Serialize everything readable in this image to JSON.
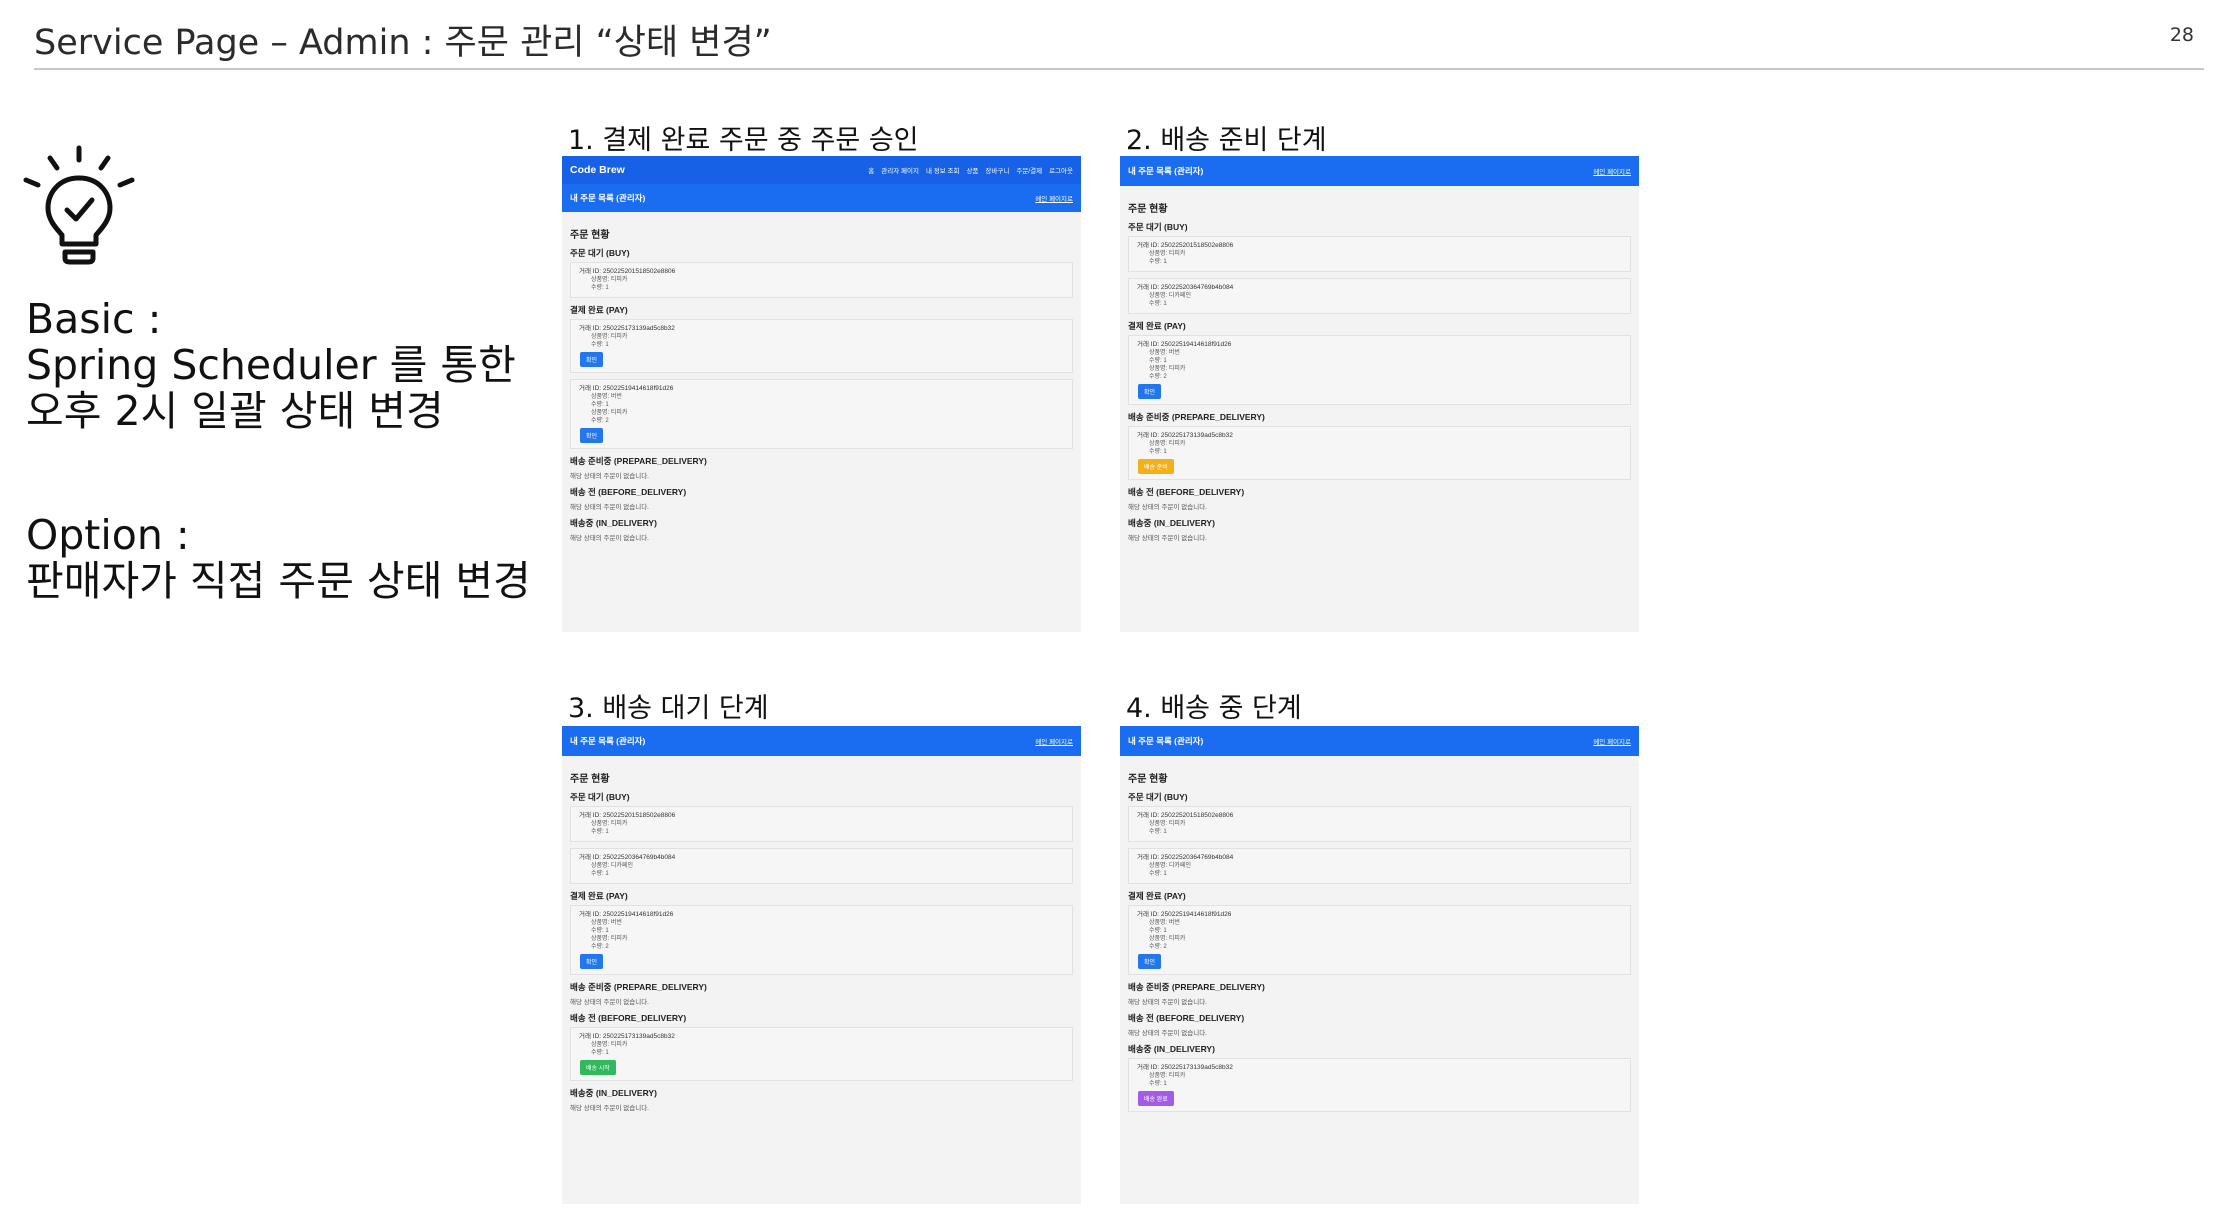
{
  "slide": {
    "title": "Service Page – Admin : 주문 관리 “상태 변경”",
    "page_number": "28",
    "basic_label": "Basic :",
    "basic_lines": [
      "Spring Scheduler 를 통한",
      "오후 2시 일괄 상태 변경"
    ],
    "option_label": "Option :",
    "option_line": "판매자가 직접 주문 상태 변경",
    "icon": "lightbulb-check-icon"
  },
  "nav": {
    "brand": "Code Brew",
    "links": [
      "홈",
      "관리자 페이지",
      "내 정보 조회",
      "상품",
      "장바구니",
      "주문/결제",
      "로그아웃"
    ]
  },
  "common": {
    "bar_title": "내 주문 목록 (관리자)",
    "mypage_link": "메인 페이지로",
    "status_heading": "주문 현황",
    "empty_text": "해당 상태의 주문이 없습니다.",
    "sec_buy": "주문 대기 (BUY)",
    "sec_pay": "결제 완료 (PAY)",
    "sec_prepare": "배송 준비중 (PREPARE_DELIVERY)",
    "sec_before": "배송 전 (BEFORE_DELIVERY)",
    "sec_in": "배송중 (IN_DELIVERY)",
    "tx_a": "거래 ID: 2502252015185​02e8806",
    "tx_b": "거래 ID: 250225173139ad5c8b32",
    "tx_c": "거래 ID: 2502251941461​8f91d26",
    "tx_d": "거래 ID: 250225203647​69b4b084",
    "prod_tiramisu": "상품명: 티피카",
    "prod_decaf": "상품명: 디카페인",
    "prod_beans": "상품명: 버번",
    "qty_1": "수량: 1",
    "qty_2": "수량: 2",
    "btn_confirm": "확인",
    "btn_prepare": "배송 준비",
    "btn_start": "배송 시작",
    "btn_done": "배송 완료"
  },
  "panels": [
    {
      "caption": "1. 결제 완료 주문 중 주문 승인"
    },
    {
      "caption": "2. 배송 준비 단계"
    },
    {
      "caption": "3. 배송 대기 단계"
    },
    {
      "caption": "4. 배송 중 단계"
    }
  ],
  "colors": {
    "accent_blue": "#1a6cf0",
    "button_blue": "#2276ee",
    "button_yellow": "#f2b019",
    "button_green": "#2fb85c",
    "button_purple": "#a35be8"
  }
}
